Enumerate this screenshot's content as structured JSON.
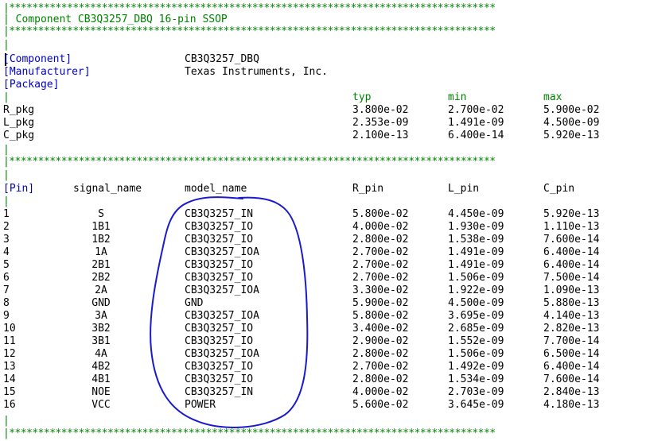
{
  "header": {
    "stars": "|************************************************************************************",
    "title": "| Component CB3Q3257_DBQ 16-pin SSOP",
    "pipe": "|"
  },
  "info": {
    "component_key": "[Component]",
    "component_val": "CB3Q3257_DBQ",
    "manufacturer_key": "[Manufacturer]",
    "manufacturer_val": "Texas Instruments, Inc.",
    "package_key": "[Package]"
  },
  "package": {
    "columns": [
      "typ",
      "min",
      "max"
    ],
    "rows": [
      {
        "name": "R_pkg",
        "typ": "3.800e-02",
        "min": "2.700e-02",
        "max": "5.900e-02"
      },
      {
        "name": "L_pkg",
        "typ": "2.353e-09",
        "min": "1.491e-09",
        "max": "4.500e-09"
      },
      {
        "name": "C_pkg",
        "typ": "2.100e-13",
        "min": "6.400e-14",
        "max": "5.920e-13"
      }
    ]
  },
  "pins": {
    "key": "[Pin]",
    "headers": [
      "signal_name",
      "model_name",
      "R_pin",
      "L_pin",
      "C_pin"
    ],
    "rows": [
      [
        "1",
        "S",
        "CB3Q3257_IN",
        "5.800e-02",
        "4.450e-09",
        "5.920e-13"
      ],
      [
        "2",
        "1B1",
        "CB3Q3257_IO",
        "4.000e-02",
        "1.930e-09",
        "1.110e-13"
      ],
      [
        "3",
        "1B2",
        "CB3Q3257_IO",
        "2.800e-02",
        "1.538e-09",
        "7.600e-14"
      ],
      [
        "4",
        "1A",
        "CB3Q3257_IOA",
        "2.700e-02",
        "1.491e-09",
        "6.400e-14"
      ],
      [
        "5",
        "2B1",
        "CB3Q3257_IO",
        "2.700e-02",
        "1.491e-09",
        "6.400e-14"
      ],
      [
        "6",
        "2B2",
        "CB3Q3257_IO",
        "2.700e-02",
        "1.506e-09",
        "7.500e-14"
      ],
      [
        "7",
        "2A",
        "CB3Q3257_IOA",
        "3.300e-02",
        "1.922e-09",
        "1.090e-13"
      ],
      [
        "8",
        "GND",
        "GND",
        "5.900e-02",
        "4.500e-09",
        "5.880e-13"
      ],
      [
        "9",
        "3A",
        "CB3Q3257_IOA",
        "5.800e-02",
        "3.695e-09",
        "4.140e-13"
      ],
      [
        "10",
        "3B2",
        "CB3Q3257_IO",
        "3.400e-02",
        "2.685e-09",
        "2.820e-13"
      ],
      [
        "11",
        "3B1",
        "CB3Q3257_IO",
        "2.900e-02",
        "1.552e-09",
        "7.700e-14"
      ],
      [
        "12",
        "4A",
        "CB3Q3257_IOA",
        "2.800e-02",
        "1.506e-09",
        "6.500e-14"
      ],
      [
        "13",
        "4B2",
        "CB3Q3257_IO",
        "2.700e-02",
        "1.492e-09",
        "6.400e-14"
      ],
      [
        "14",
        "4B1",
        "CB3Q3257_IO",
        "2.800e-02",
        "1.534e-09",
        "7.600e-14"
      ],
      [
        "15",
        "NOE",
        "CB3Q3257_IN",
        "4.000e-02",
        "2.703e-09",
        "2.840e-13"
      ],
      [
        "16",
        "VCC",
        "POWER",
        "5.600e-02",
        "3.645e-09",
        "4.180e-13"
      ]
    ]
  },
  "colors": {
    "comment": "#008000",
    "keyword": "#0000c8",
    "text": "#000000",
    "annotation": "#1a1acd"
  }
}
